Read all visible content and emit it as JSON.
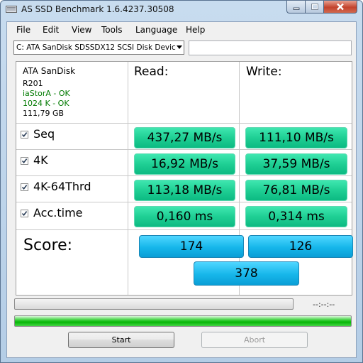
{
  "window": {
    "title": "AS SSD Benchmark 1.6.4237.30508",
    "buttons": {
      "minimize_icon": "minimize-icon",
      "maximize_icon": "maximize-icon",
      "close_icon": "close-icon"
    }
  },
  "menu": {
    "items": [
      "File",
      "Edit",
      "View",
      "Tools",
      "Language",
      "Help"
    ]
  },
  "drive": {
    "selected": "C: ATA SanDisk SDSSDX12 SCSI Disk Devic",
    "path_value": ""
  },
  "device_info": {
    "name": "ATA SanDisk",
    "firmware": "R201",
    "driver_status": "iaStorA - OK",
    "alignment_status": "1024 K - OK",
    "capacity": "111,79 GB",
    "ok_color": "#007a00"
  },
  "columns": {
    "read": "Read:",
    "write": "Write:"
  },
  "rows": [
    {
      "label": "Seq",
      "checked": true,
      "read": "437,27 MB/s",
      "write": "111,10 MB/s"
    },
    {
      "label": "4K",
      "checked": true,
      "read": "16,92 MB/s",
      "write": "37,59 MB/s"
    },
    {
      "label": "4K-64Thrd",
      "checked": true,
      "read": "113,18 MB/s",
      "write": "76,81 MB/s"
    },
    {
      "label": "Acc.time",
      "checked": true,
      "read": "0,160 ms",
      "write": "0,314 ms"
    }
  ],
  "score": {
    "label": "Score:",
    "read": "174",
    "write": "126",
    "total": "378"
  },
  "progress": {
    "elapsed": "--:--:--",
    "bar_fraction": 0,
    "status_fraction": 1
  },
  "buttons": {
    "start": "Start",
    "abort": "Abort"
  },
  "colors": {
    "result_green": "#1fcf94",
    "score_blue": "#16b6ea",
    "progress_green": "#06b506"
  }
}
